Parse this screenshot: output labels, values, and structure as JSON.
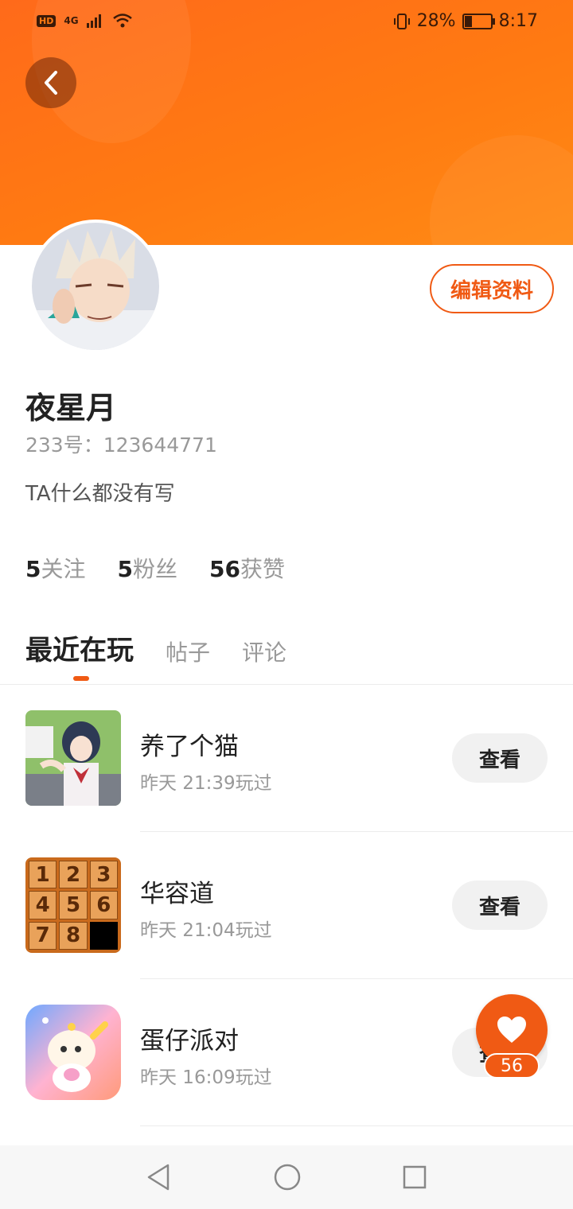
{
  "status_bar": {
    "network": "4G",
    "hd": "HD",
    "battery_percent": "28%",
    "battery_level": 0.28,
    "time": "8:17"
  },
  "profile": {
    "username": "夜星月",
    "id_label": "233号：",
    "id_value": "123644771",
    "bio": "TA什么都没有写",
    "edit_label": "编辑资料"
  },
  "stats": [
    {
      "count": "5",
      "label": "关注"
    },
    {
      "count": "5",
      "label": "粉丝"
    },
    {
      "count": "56",
      "label": "获赞"
    }
  ],
  "tabs": [
    {
      "label": "最近在玩",
      "active": true
    },
    {
      "label": "帖子",
      "active": false
    },
    {
      "label": "评论",
      "active": false
    }
  ],
  "games": [
    {
      "name": "养了个猫",
      "played": "昨天 21:39玩过",
      "action": "查看"
    },
    {
      "name": "华容道",
      "played": "昨天 21:04玩过",
      "action": "查看"
    },
    {
      "name": "蛋仔派对",
      "played": "昨天 16:09玩过",
      "action": "查看"
    }
  ],
  "puzzle_tiles": [
    "1",
    "2",
    "3",
    "4",
    "5",
    "6",
    "7",
    "8"
  ],
  "fab": {
    "count": "56"
  },
  "colors": {
    "accent": "#f05a14",
    "header": "#ff7a12"
  }
}
